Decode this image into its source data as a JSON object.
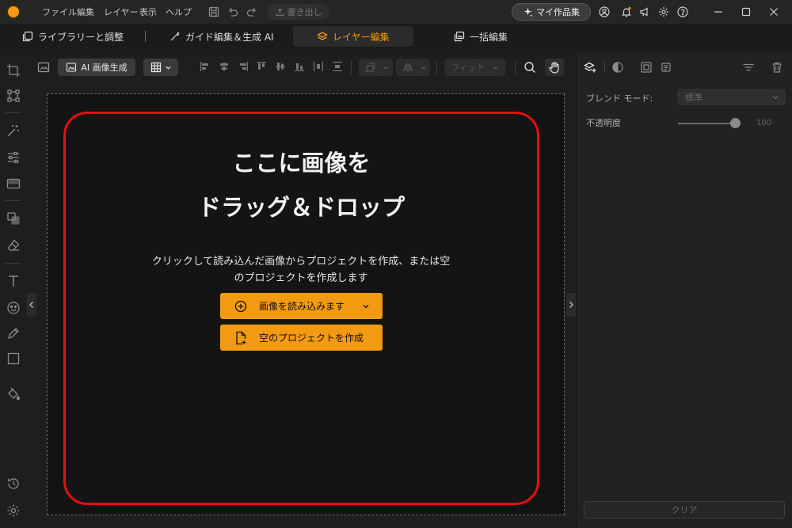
{
  "menu": {
    "items": [
      "ファイル",
      "編集",
      "レイヤー",
      "表示",
      "ヘルプ"
    ],
    "export_label": "書き出し",
    "my_works_label": "マイ作品集"
  },
  "tabs": [
    {
      "label": "ライブラリーと調整"
    },
    {
      "label": "ガイド編集＆生成 AI"
    },
    {
      "label": "レイヤー編集"
    },
    {
      "label": "一括編集"
    }
  ],
  "toolbar": {
    "ai_generate_label": "AI 画像生成",
    "fit_label": "フィット"
  },
  "canvas": {
    "title_line1": "ここに画像を",
    "title_line2": "ドラッグ＆ドロップ",
    "description_line1": "クリックして読み込んだ画像からプロジェクトを作成、または空",
    "description_line2": "のプロジェクトを作成します",
    "load_image_label": "画像を読み込みます",
    "new_project_label": "空のプロジェクトを作成"
  },
  "right_panel": {
    "blend_mode_label": "ブレンド モード:",
    "blend_mode_value": "標準",
    "opacity_label": "不透明度",
    "opacity_value": "100",
    "clear_label": "クリア"
  },
  "colors": {
    "accent": "#f39a13",
    "highlight_border": "#e01010",
    "background": "#1e1e1e"
  },
  "icons": [
    "app-logo-icon",
    "save-icon",
    "undo-icon",
    "redo-icon",
    "export-icon",
    "sparkle-icon",
    "account-icon",
    "bell-icon",
    "megaphone-icon",
    "gear-icon",
    "help-icon",
    "minimize-icon",
    "maximize-icon",
    "close-icon",
    "library-icon",
    "guide-edit-icon",
    "layers-icon",
    "batch-icon",
    "crop-icon",
    "transform-icon",
    "magic-wand-icon",
    "adjust-icon",
    "gradient-icon",
    "clone-icon",
    "eraser-icon",
    "text-icon",
    "sticker-icon",
    "pen-icon",
    "rectangle-icon",
    "fill-icon",
    "history-icon",
    "settings-icon",
    "plus-circle-icon",
    "new-file-icon",
    "search-icon",
    "hand-icon",
    "trash-icon"
  ]
}
